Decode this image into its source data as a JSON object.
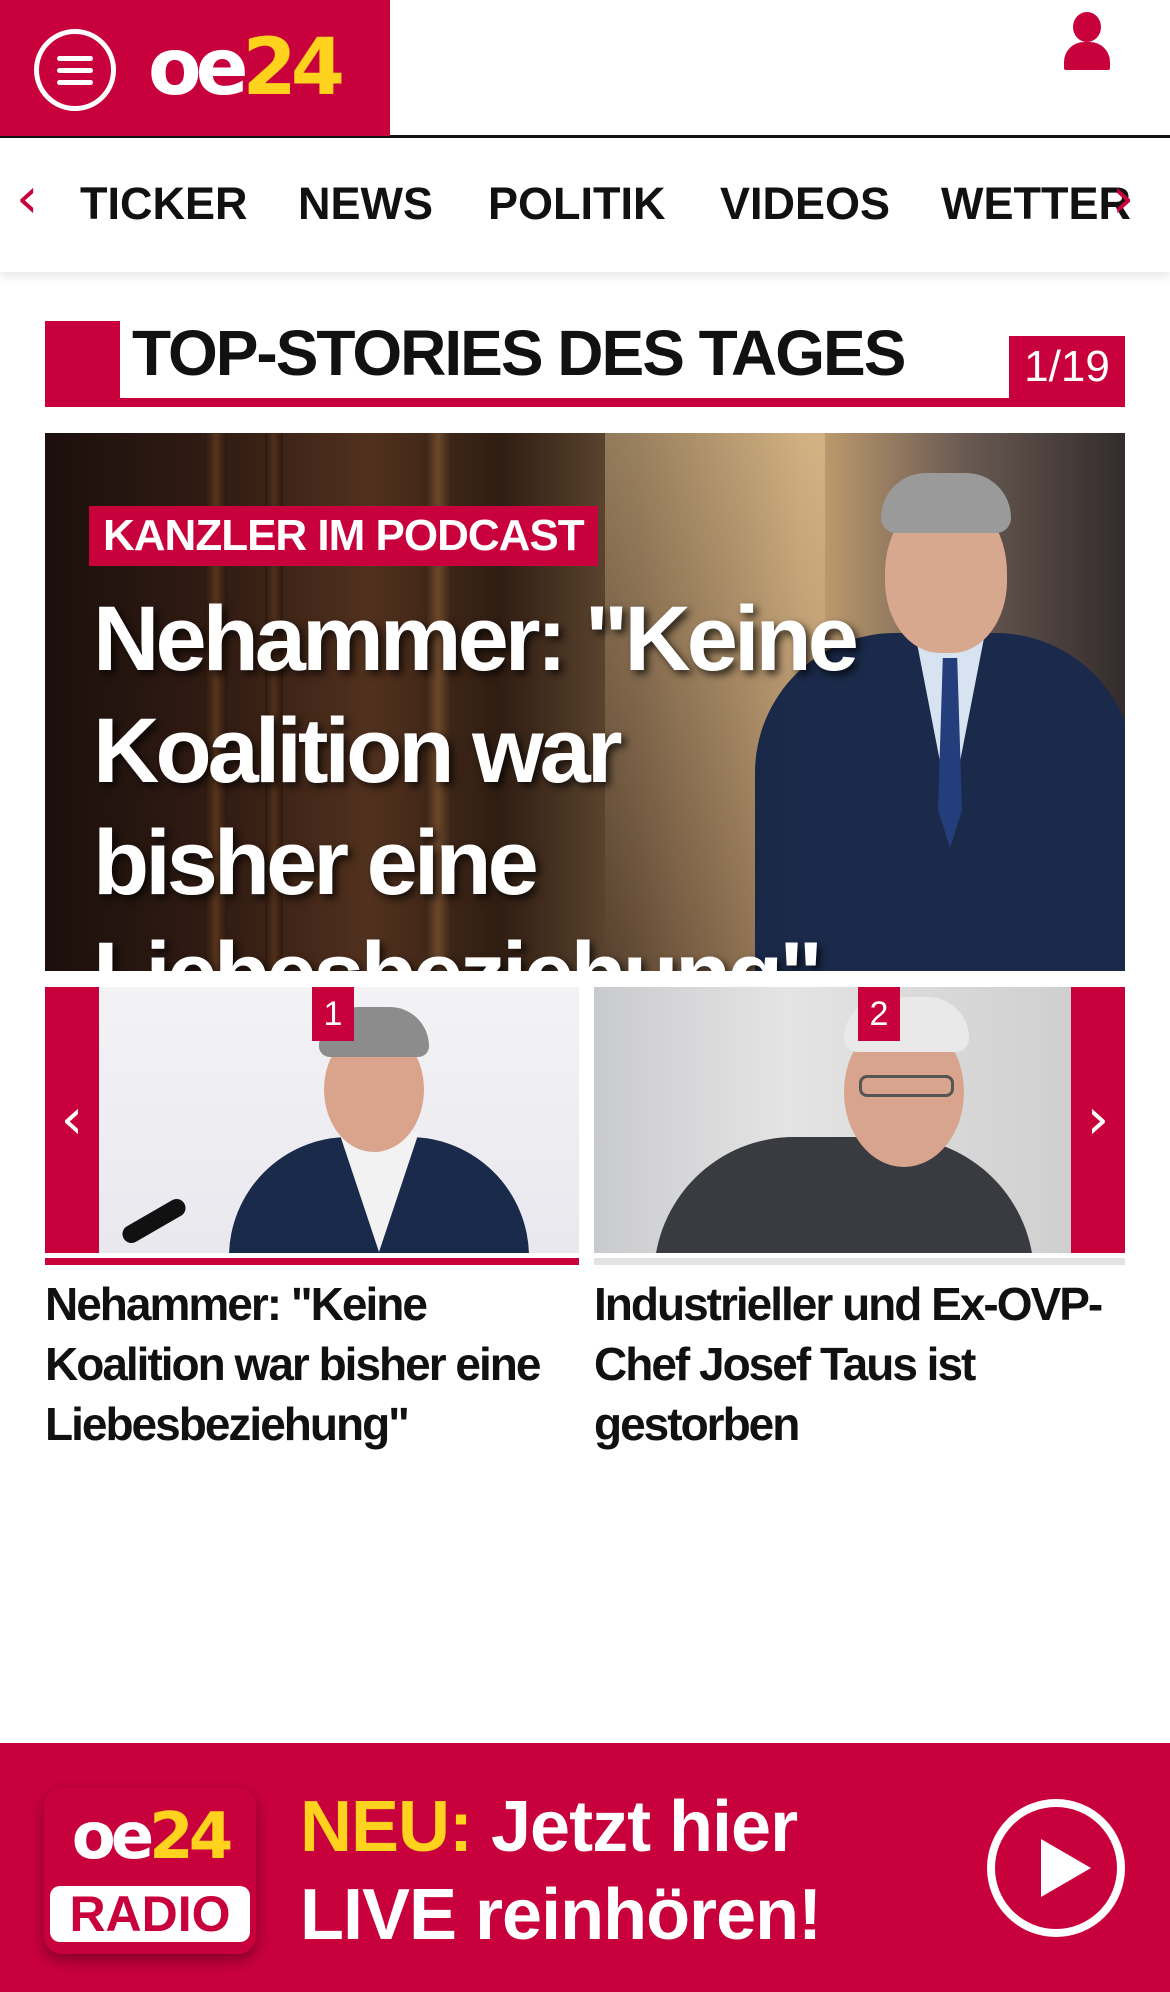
{
  "header": {
    "logo_oe": "oe",
    "logo_num": "24",
    "menu_icon": "hamburger-menu-icon",
    "user_icon": "user-icon"
  },
  "nav": {
    "items": [
      "TICKER",
      "NEWS",
      "POLITIK",
      "VIDEOS",
      "WETTER"
    ],
    "prev_arrow": "‹",
    "next_arrow": "›"
  },
  "section": {
    "title": "TOP-STORIES DES TAGES",
    "counter": "1/19"
  },
  "hero": {
    "kicker": "KANZLER IM PODCAST",
    "headline": "Nehammer: \"Keine Koalition war bisher eine Liebesbeziehung\""
  },
  "carousel": {
    "prev_arrow": "‹",
    "next_arrow": "›",
    "cards": [
      {
        "badge": "1",
        "title": "Nehammer: \"Keine Koalition war bisher eine Liebesbeziehung\""
      },
      {
        "badge": "2",
        "title": "Industrieller und Ex-OVP-Chef Josef Taus ist gestorben"
      }
    ]
  },
  "radio": {
    "logo_oe": "oe",
    "logo_num": "24",
    "logo_label": "RADIO",
    "highlight": "NEU:",
    "line1": " Jetzt hier",
    "line2": "LIVE reinhören!",
    "play_icon": "play-icon"
  },
  "colors": {
    "brand": "#c8003c",
    "accent": "#ffd21e"
  }
}
